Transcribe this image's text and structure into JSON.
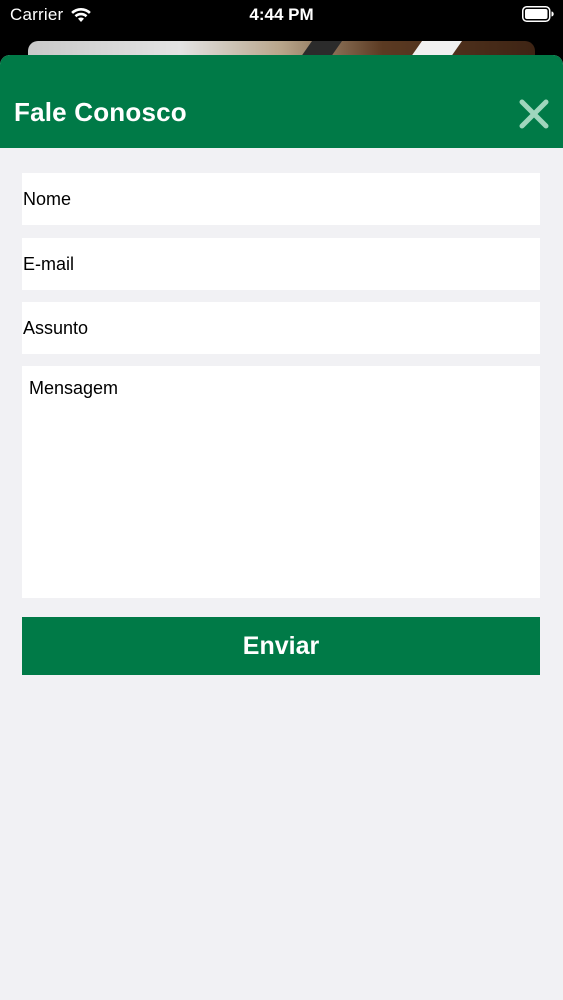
{
  "status_bar": {
    "carrier": "Carrier",
    "time": "4:44 PM",
    "wifi_icon": "wifi-icon",
    "battery_icon": "battery-icon"
  },
  "modal": {
    "title": "Fale Conosco",
    "close_icon": "close-icon",
    "fields": {
      "name_placeholder": "Nome",
      "email_placeholder": "E-mail",
      "subject_placeholder": "Assunto",
      "message_placeholder": "Mensagem"
    },
    "submit_label": "Enviar"
  },
  "colors": {
    "brand_green": "#007a47",
    "sheet_background": "#f1f1f4",
    "field_background": "#ffffff",
    "close_icon": "#9fd6bd"
  }
}
